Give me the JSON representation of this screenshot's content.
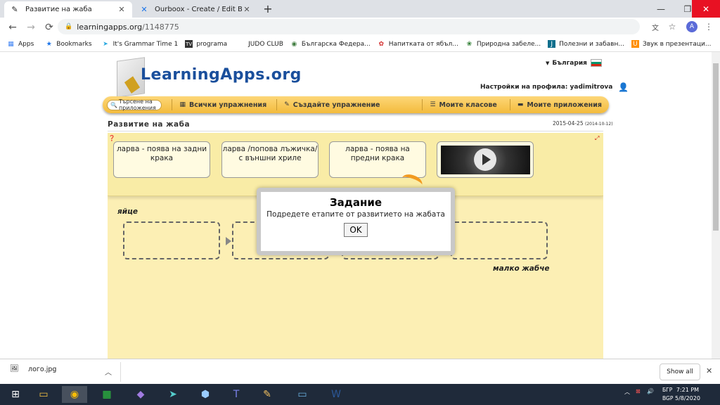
{
  "browser": {
    "tabs": [
      {
        "title": "Развитие на жаба",
        "favicon": "learningapps-icon",
        "active": true
      },
      {
        "title": "Ourboox - Create / Edit Book",
        "favicon": "ourboox-icon",
        "active": false
      }
    ],
    "new_tab": "+",
    "window_controls": {
      "minimize": "—",
      "maximize": "❐",
      "close": "✕"
    },
    "nav": {
      "back": "←",
      "forward": "→",
      "reload": "⟳"
    },
    "address": {
      "host": "learningapps.org",
      "path": "/1148775"
    },
    "bookmarks": [
      {
        "label": "Apps",
        "icon": "apps-grid-icon",
        "color": "#4285f4"
      },
      {
        "label": "Bookmarks",
        "icon": "star-icon",
        "color": "#1a73e8"
      },
      {
        "label": "It's Grammar Time 1",
        "icon": "paper-plane-icon",
        "color": "#29a8e0"
      },
      {
        "label": "programa",
        "icon": "tv-icon",
        "color": "#333333"
      },
      {
        "label": "JUDO CLUB",
        "icon": "",
        "color": "#333333"
      },
      {
        "label": "Българска Федера...",
        "icon": "shield-icon",
        "color": "#3c7a3c"
      },
      {
        "label": "Напитката от ябъл...",
        "icon": "apple-icon",
        "color": "#d32f2f"
      },
      {
        "label": "Природна забеле...",
        "icon": "flower-icon",
        "color": "#2e7d32"
      },
      {
        "label": "Полезни и забавн...",
        "icon": "j-icon",
        "color": "#0d6e8c"
      },
      {
        "label": "Звук в презентаци...",
        "icon": "u-icon",
        "color": "#ff8f00"
      }
    ]
  },
  "site": {
    "logo_text": "LearningApps.org",
    "country": "България",
    "profile_label": "Настройки на профила: yadimitrova",
    "search_placeholder": "Търсене на приложения",
    "nav": [
      {
        "label": "Всички упражнения",
        "icon": "grid-icon"
      },
      {
        "label": "Създайте упражнение",
        "icon": "pencil-icon"
      },
      {
        "label": "Моите класове",
        "icon": "list-icon"
      },
      {
        "label": "Моите приложения",
        "icon": "folder-icon"
      }
    ],
    "app_title": "Развитие на жаба",
    "app_date": "2015-04-25",
    "app_date_small": "(2014-10-12)"
  },
  "app": {
    "cards": [
      "ларва - поява на задни крака",
      "ларва /попова лъжичка/ с външни хриле",
      "ларва - поява на предни крака"
    ],
    "video_label": "video",
    "label_start": "яйце",
    "label_end": "малко жабче",
    "modal": {
      "title": "Задание",
      "text": "Подредете етапите от развитието на жабата",
      "ok": "OK"
    }
  },
  "downloads": {
    "file": "лого.jpg",
    "show_all": "Show all"
  },
  "taskbar": {
    "lang_1": "БГР",
    "lang_2": "BGP",
    "time": "7:21 PM",
    "date": "5/8/2020"
  }
}
